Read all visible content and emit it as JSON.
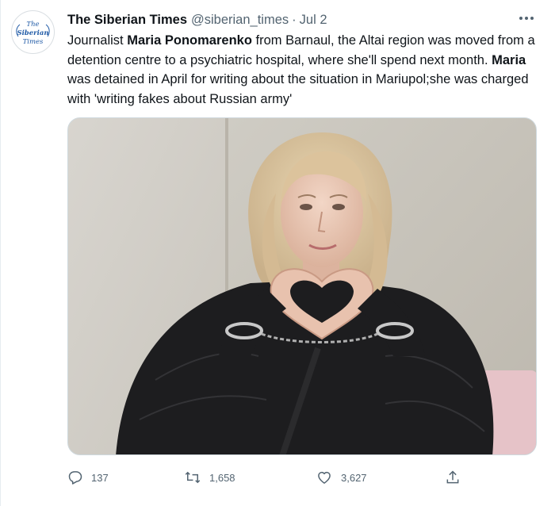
{
  "tweet": {
    "author": {
      "name": "The Siberian Times",
      "handle": "@siberian_times",
      "avatar_lines": [
        "The",
        "Siberian",
        "Times"
      ]
    },
    "separator": "·",
    "date": "Jul 2",
    "text": {
      "p1": "Journalist ",
      "b1": "Maria Ponomarenko",
      "p2": " from Barnaul, the Altai region was moved from a detention centre to a psychiatric hospital, where she'll spend next month. ",
      "b2": "Maria",
      "p3": " was detained in April for writing about the situation in Mariupol;she was charged with 'writing fakes about Russian army'"
    },
    "media_description": "Photo of a blonde woman in a black quilted jacket and handcuffs making a heart shape with her hands",
    "stats": {
      "replies": "137",
      "retweets": "1,658",
      "likes": "3,627"
    }
  },
  "icons": {
    "more": "more-horizontal-icon",
    "reply": "reply-icon",
    "retweet": "retweet-icon",
    "like": "heart-icon",
    "share": "share-icon"
  },
  "colors": {
    "text": "#0f1419",
    "secondary": "#536471",
    "border": "#cfd9de",
    "avatar_logo": "#1f5aa6"
  }
}
